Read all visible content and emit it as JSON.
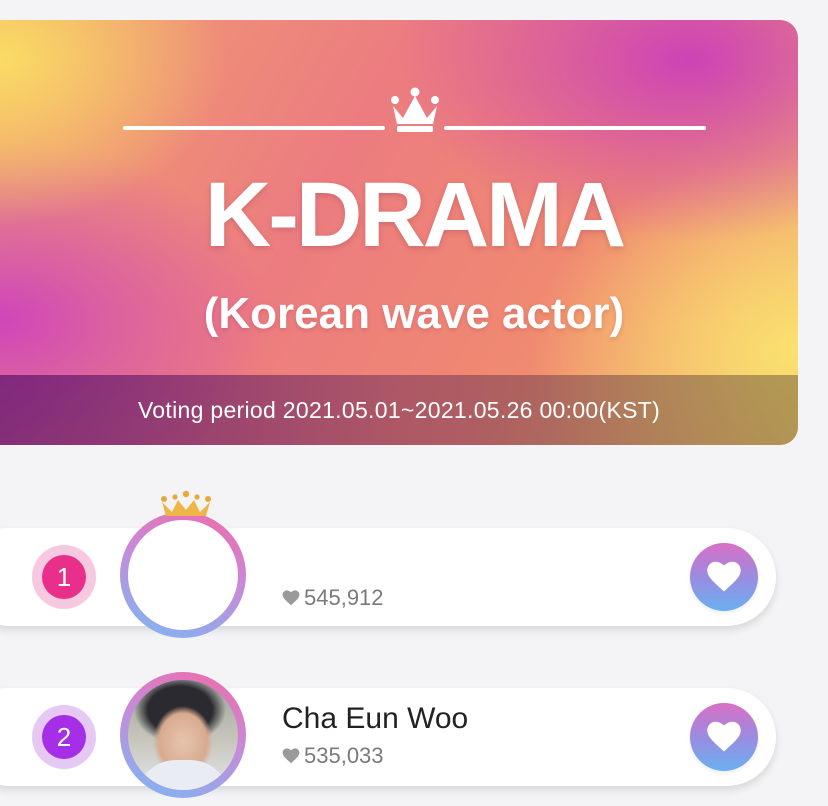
{
  "banner": {
    "title": "K-DRAMA",
    "subtitle": "(Korean wave actor)",
    "voting_period": "Voting period 2021.05.01~2021.05.26 00:00(KST)"
  },
  "ranking": [
    {
      "rank": "1",
      "name": "",
      "votes": "545,912"
    },
    {
      "rank": "2",
      "name": "Cha Eun Woo",
      "votes": "535,033"
    }
  ],
  "icons": {
    "banner_crown": "crown-icon",
    "top_crown": "crown-icon",
    "vote_heart": "heart-icon",
    "vote_count": "heart-icon"
  },
  "colors": {
    "rank1_badge": "#e8308a",
    "rank2_badge": "#a52ee6",
    "heart_gradient_top": "#d96fc6",
    "heart_gradient_bottom": "#6ab1f0"
  }
}
